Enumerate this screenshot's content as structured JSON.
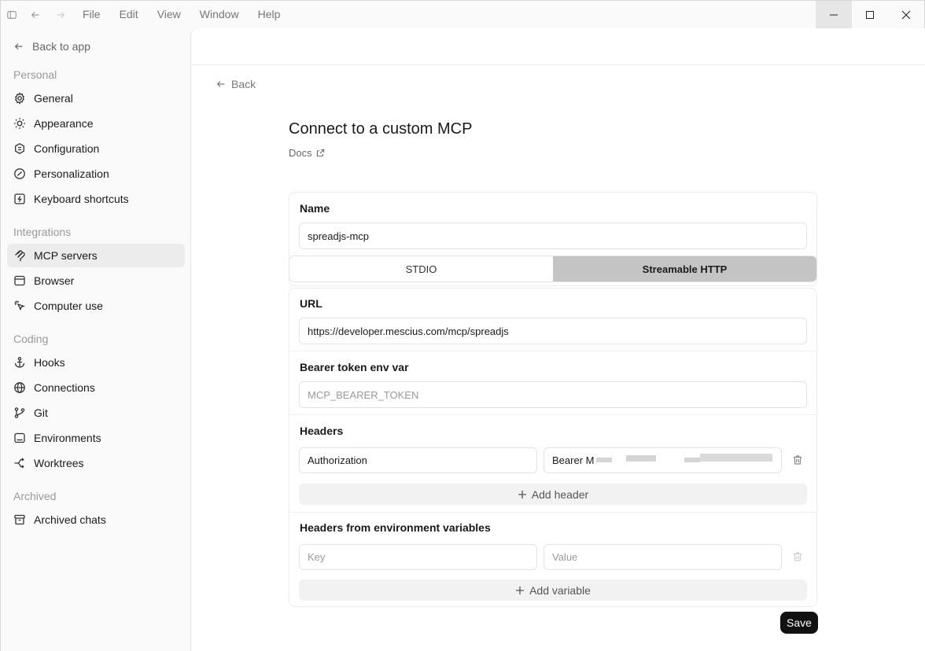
{
  "menu": [
    "File",
    "Edit",
    "View",
    "Window",
    "Help"
  ],
  "sidebar": {
    "back": "Back to app",
    "sections": {
      "personal": "Personal",
      "integrations": "Integrations",
      "coding": "Coding",
      "archived": "Archived"
    },
    "items": {
      "general": "General",
      "appearance": "Appearance",
      "configuration": "Configuration",
      "personalization": "Personalization",
      "keyboard": "Keyboard shortcuts",
      "mcp": "MCP servers",
      "browser": "Browser",
      "computer_use": "Computer use",
      "hooks": "Hooks",
      "connections": "Connections",
      "git": "Git",
      "environments": "Environments",
      "worktrees": "Worktrees",
      "archived_chats": "Archived chats"
    },
    "active": "mcp"
  },
  "main": {
    "back": "Back",
    "title": "Connect to a custom MCP",
    "docs": "Docs",
    "name_label": "Name",
    "name_value": "spreadjs-mcp",
    "transport": {
      "stdio": "STDIO",
      "http": "Streamable HTTP",
      "selected": "http"
    },
    "url_label": "URL",
    "url_value": "https://developer.mescius.com/mcp/spreadjs",
    "bearer_label": "Bearer token env var",
    "bearer_placeholder": "MCP_BEARER_TOKEN",
    "headers_label": "Headers",
    "header_key": "Authorization",
    "header_value": "Bearer M",
    "add_header": "Add header",
    "env_headers_label": "Headers from environment variables",
    "env_key_placeholder": "Key",
    "env_value_placeholder": "Value",
    "add_variable": "Add variable",
    "save": "Save"
  }
}
